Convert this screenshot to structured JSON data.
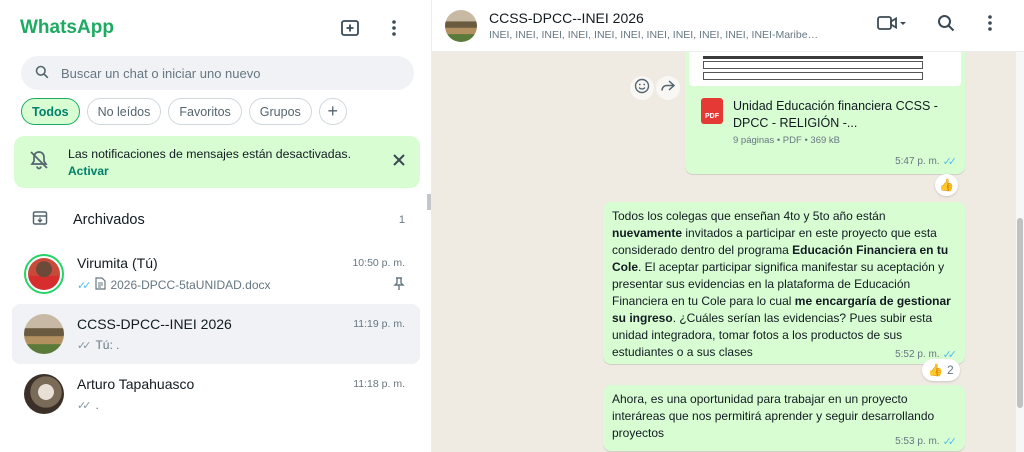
{
  "sidebar": {
    "brand": "WhatsApp",
    "search_placeholder": "Buscar un chat o iniciar uno nuevo",
    "chips": [
      "Todos",
      "No leídos",
      "Favoritos",
      "Grupos",
      "+"
    ],
    "notification": {
      "text": "Las notificaciones de mensajes están desactivadas.",
      "action": "Activar"
    },
    "archived": {
      "label": "Archivados",
      "count": "1"
    },
    "chats": [
      {
        "name": "Virumita (Tú)",
        "time": "10:50 p. m.",
        "preview": "2026-DPCC-5taUNIDAD.docx"
      },
      {
        "name": "CCSS-DPCC--INEI 2026",
        "time": "11:19 p. m.",
        "preview": "Tú: ."
      },
      {
        "name": "Arturo Tapahuasco",
        "time": "11:18 p. m.",
        "preview": "."
      }
    ]
  },
  "conversation": {
    "title": "CCSS-DPCC--INEI 2026",
    "members": "INEI, INEI, INEI, INEI, INEI, INEI, INEI, INEI, INEI, INEI, INEI-Maribel, Tú",
    "document": {
      "name": "Unidad Educación financiera CCSS - DPCC - RELIGIÓN -...",
      "meta": "9 páginas • PDF • 369 kB",
      "badge": "PDF",
      "time": "5:47 p. m."
    },
    "reaction1": "👍",
    "message1": {
      "parts": [
        {
          "t": "Todos los colegas que enseñan 4to y 5to año están ",
          "b": false
        },
        {
          "t": "nuevamente",
          "b": true
        },
        {
          "t": " invitados a participar en este proyecto que esta considerado dentro del programa ",
          "b": false
        },
        {
          "t": "Educación Financiera en tu Cole",
          "b": true
        },
        {
          "t": ". El aceptar participar significa manifestar su aceptación y presentar sus evidencias en la plataforma de Educación Financiera en tu Cole para lo cual ",
          "b": false
        },
        {
          "t": "me encargaría de gestionar su ingreso",
          "b": true
        },
        {
          "t": ". ¿Cuáles serían las evidencias? Pues subir esta unidad integradora, tomar fotos a los productos de sus estudiantes o a sus clases",
          "b": false
        }
      ],
      "time": "5:52 p. m."
    },
    "reaction2": {
      "emoji": "👍",
      "count": "2"
    },
    "message2": {
      "text": "Ahora, es una oportunidad para trabajar en un proyecto interáreas que nos permitirá aprender y seguir desarrollando proyectos",
      "time": "5:53 p. m."
    }
  },
  "colors": {
    "accent": "#1daa61",
    "bubble": "#d9fdd3",
    "read_tick": "#53bdeb"
  }
}
